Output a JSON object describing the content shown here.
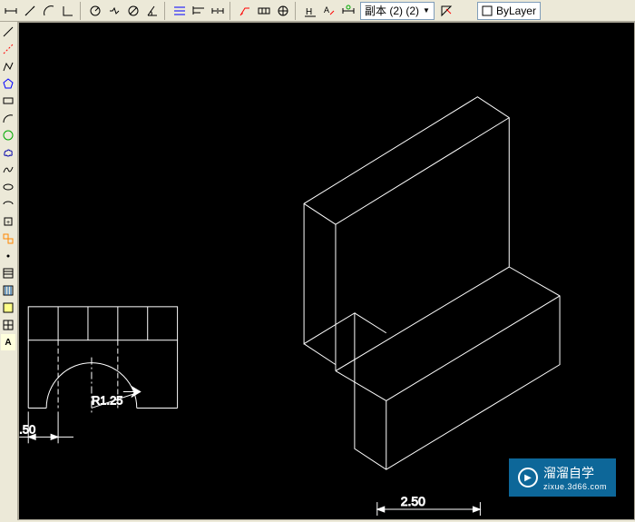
{
  "toolbar": {
    "dropdown1_label": "副本 (2) (2)",
    "dropdown2_label": "ByLayer"
  },
  "icons": {
    "linear_dim": "⟷",
    "aligned_dim": "⤢",
    "arc_dim": "◠",
    "radius_dim": "⦰",
    "diameter_dim": "⊘",
    "angle_dim": "∠",
    "center_mark": "⊕",
    "continue_dim": "⟼",
    "baseline_dim": "⟼",
    "leader": "✎",
    "tolerance": "⊞",
    "dim_edit": "▯",
    "text_icon": "A",
    "style_icon": "✎"
  },
  "left_tools": {
    "line": "╱",
    "construction": "╱",
    "polyline": "∿",
    "polygon": "⬠",
    "rectangle": "▭",
    "arc": "◠",
    "circle": "○",
    "revcloud": "☁",
    "spline": "∿",
    "ellipse": "⬭",
    "ellipse_arc": "⬬",
    "insert": "▣",
    "block": "▦",
    "point": "·",
    "hatch": "▨",
    "region": "▤",
    "table": "▦",
    "mtext": "A"
  },
  "drawing": {
    "dim_radius": "R1.25",
    "dim_left": ".50",
    "dim_bottom": "2.50"
  },
  "watermark": {
    "title": "溜溜自学",
    "subtitle": "zixue.3d66.com"
  }
}
